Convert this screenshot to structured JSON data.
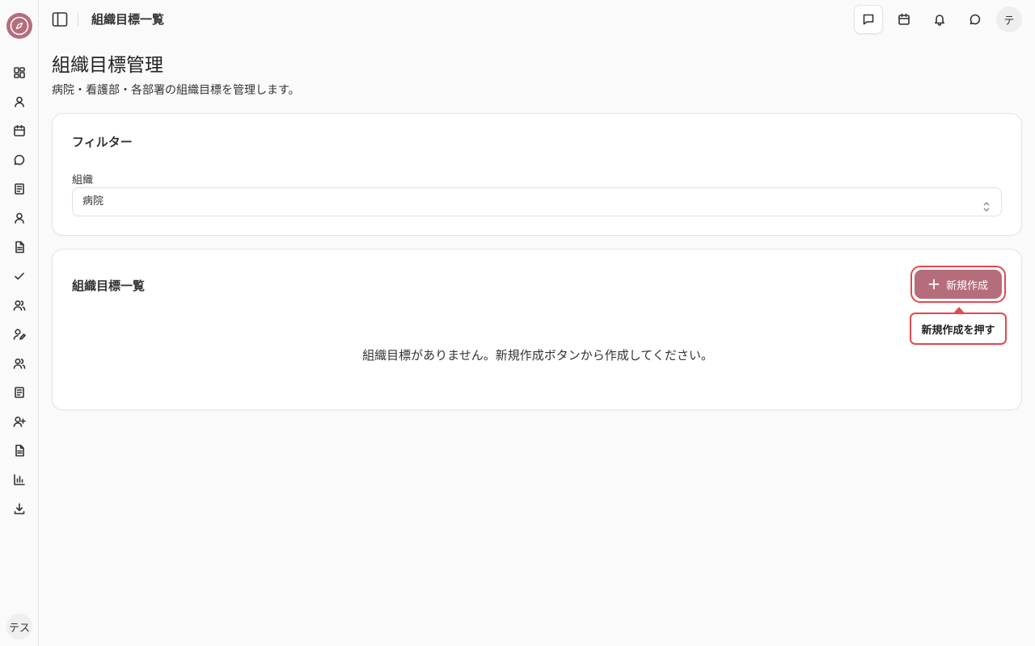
{
  "sidebar": {
    "icons": [
      "dashboard-icon",
      "user-icon",
      "calendar-icon",
      "chat-icon",
      "book-icon",
      "user-icon",
      "document-icon",
      "check-icon",
      "users-icon",
      "user-edit-icon",
      "users-icon",
      "book-icon",
      "user-plus-icon",
      "document-icon",
      "bar-chart-icon",
      "download-icon"
    ],
    "user_initials": "テス"
  },
  "header": {
    "title": "組織目標一覧",
    "avatar_initial": "テ"
  },
  "page": {
    "title": "組織目標管理",
    "description": "病院・看護部・各部署の組織目標を管理します。"
  },
  "filter": {
    "heading": "フィルター",
    "org_label": "組織",
    "org_value": "病院"
  },
  "list": {
    "heading": "組織目標一覧",
    "new_button_label": "新規作成",
    "tooltip": "新規作成を押す",
    "empty_message": "組織目標がありません。新規作成ボタンから作成してください。"
  },
  "colors": {
    "accent": "#b66d7b",
    "highlight": "#e5484d"
  }
}
